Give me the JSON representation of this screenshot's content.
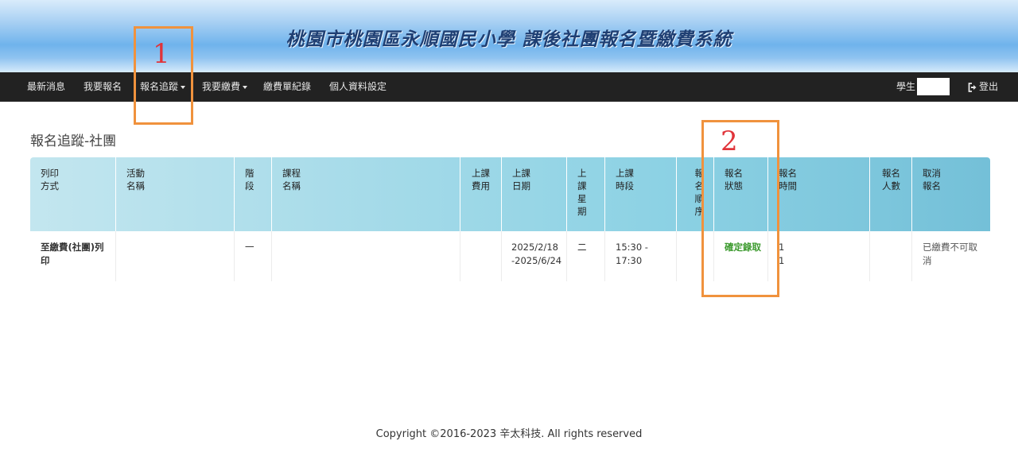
{
  "header": {
    "title": "桃園市桃園區永順國民小學 課後社團報名暨繳費系統"
  },
  "nav": {
    "items": [
      {
        "label": "最新消息"
      },
      {
        "label": "我要報名"
      },
      {
        "label": "報名追蹤"
      },
      {
        "label": "我要繳費"
      },
      {
        "label": "繳費單紀錄"
      },
      {
        "label": "個人資料設定"
      }
    ],
    "user_label": "學生",
    "logout_label": "登出"
  },
  "page": {
    "title": "報名追蹤-社團"
  },
  "table": {
    "headers": [
      "列印\n方式",
      "活動\n名稱",
      "階\n段",
      "課程\n名稱",
      "上課\n費用",
      "上課\n日期",
      "上\n課\n星\n期",
      "上課\n時段",
      "報\n名\n順\n序",
      "報名\n狀態",
      "報名\n時間",
      "報名\n人數",
      "取消\n報名"
    ],
    "rows": [
      {
        "print_method": "至繳費(社團)列印",
        "activity": "",
        "stage": "一",
        "course": "",
        "fee": "",
        "dates": "2025/2/18\n-2025/6/24",
        "weekday": "二",
        "time": "15:30 -\n17:30",
        "order": "",
        "status": "確定錄取",
        "reg_time": "1\n1",
        "count": "",
        "cancel": "已繳費不可取消"
      }
    ]
  },
  "annotations": [
    {
      "label": "1"
    },
    {
      "label": "2"
    }
  ],
  "footer": {
    "copyright": "Copyright ©2016-2023 辛太科技. All rights reserved"
  },
  "colors": {
    "navbar": "#222222",
    "annotation_box": "#f0923d",
    "annotation_number": "#e0343a",
    "status_ok": "#3c9a2e"
  }
}
